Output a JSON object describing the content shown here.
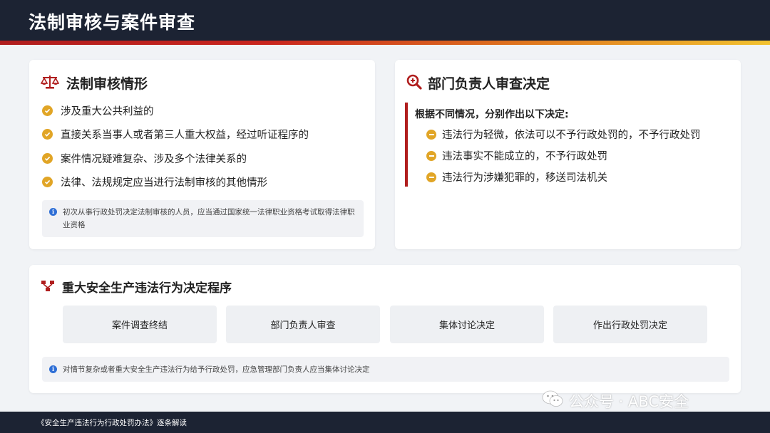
{
  "header": {
    "title": "法制审核与案件审查"
  },
  "legal_review": {
    "title": "法制审核情形",
    "items": [
      "涉及重大公共利益的",
      "直接关系当事人或者第三人重大权益，经过听证程序的",
      "案件情况疑难复杂、涉及多个法律关系的",
      "法律、法规规定应当进行法制审核的其他情形"
    ],
    "note": "初次从事行政处罚决定法制审核的人员，应当通过国家统一法律职业资格考试取得法律职业资格"
  },
  "dept_review": {
    "title": "部门负责人审查决定",
    "heading": "根据不同情况，分别作出以下决定:",
    "items": [
      "违法行为轻微，依法可以不予行政处罚的，不予行政处罚",
      "违法事实不能成立的，不予行政处罚",
      "违法行为涉嫌犯罪的，移送司法机关"
    ]
  },
  "procedure": {
    "title": "重大安全生产违法行为决定程序",
    "steps": [
      "案件调查终结",
      "部门负责人审查",
      "集体讨论决定",
      "作出行政处罚决定"
    ],
    "note": "对情节复杂或者重大安全生产违法行为给予行政处罚，应急管理部门负责人应当集体讨论决定"
  },
  "footer": {
    "text": "《安全生产违法行为行政处罚办法》逐条解读"
  },
  "watermark": {
    "text": "公众号 · ABC安全"
  },
  "icons": {
    "scale": "balance-scale-icon",
    "search": "search-magnifier-icon",
    "flow": "sitemap-icon",
    "check": "check-circle-icon",
    "minus": "minus-circle-icon",
    "info": "info-circle-icon",
    "wechat": "wechat-icon"
  },
  "colors": {
    "header_bg": "#1c2333",
    "accent_red": "#b01e1e",
    "accent_gold": "#e1a526",
    "info_blue": "#2f6fd6",
    "page_bg": "#f1f3f6"
  }
}
